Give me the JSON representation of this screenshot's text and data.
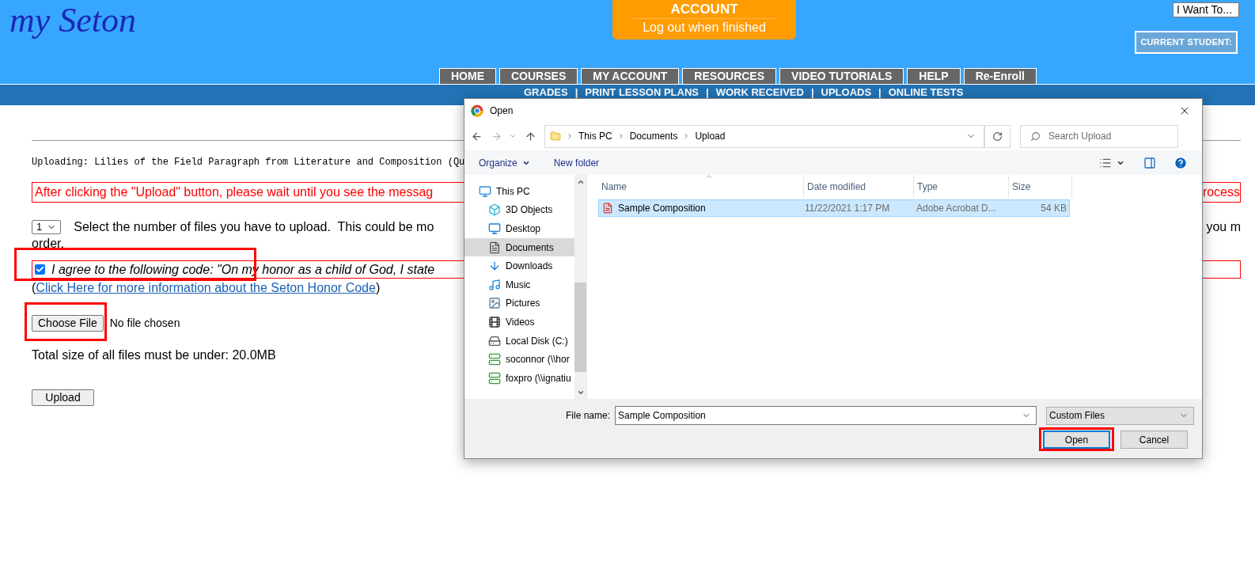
{
  "header": {
    "logo": "my Seton",
    "account": {
      "title": "ACCOUNT",
      "subtitle": "Log out when finished"
    },
    "i_want_to": "I Want To...",
    "current_student": "CURRENT STUDENT:"
  },
  "nav_tabs": [
    {
      "label": "HOME"
    },
    {
      "label": "COURSES"
    },
    {
      "label": "MY ACCOUNT"
    },
    {
      "label": "RESOURCES"
    },
    {
      "label": "VIDEO TUTORIALS"
    },
    {
      "label": "HELP"
    },
    {
      "label": "Re-Enroll"
    }
  ],
  "sub_nav": {
    "separator": "|",
    "items": [
      "GRADES",
      "PRINT LESSON PLANS",
      "WORK RECEIVED",
      "UPLOADS",
      "ONLINE TESTS"
    ]
  },
  "upload_form": {
    "uploading": "Uploading: Lilies of the Field Paragraph from Literature and Composition (Qu",
    "warning": {
      "left": "After clicking the \"Upload\" button, please wait until you see the messag",
      "right": "rocess"
    },
    "file_count": {
      "value": "1",
      "text_left": "Select the number of files you have to upload.  This could be mo",
      "text_right": "you m",
      "text_wrap": "order."
    },
    "honor_code": {
      "checked": true,
      "highlighted": true,
      "label": "I agree to the following code: \"On my honor as a child of God, I state"
    },
    "honor_link": {
      "open": "(",
      "link": "Click Here for more information about the Seton Honor Code",
      "close": ")"
    },
    "choose_file": {
      "button": "Choose File",
      "status": "No file chosen",
      "highlighted": true
    },
    "size_note": "Total size of all files must be under: 20.0MB",
    "upload_button": "Upload"
  },
  "dialog": {
    "title": "Open",
    "path": [
      "This PC",
      "Documents",
      "Upload"
    ],
    "search_placeholder": "Search Upload",
    "toolbar": [
      "Organize",
      "New folder"
    ],
    "nav_pane": [
      {
        "label": "This PC",
        "selected": false,
        "children": [
          {
            "label": "3D Objects",
            "selected": false
          },
          {
            "label": "Desktop",
            "selected": false
          },
          {
            "label": "Documents",
            "selected": true
          },
          {
            "label": "Downloads",
            "selected": false
          },
          {
            "label": "Music",
            "selected": false
          },
          {
            "label": "Pictures",
            "selected": false
          },
          {
            "label": "Videos",
            "selected": false
          },
          {
            "label": "Local Disk (C:)",
            "selected": false
          },
          {
            "label": "soconnor (\\\\hor",
            "selected": false
          },
          {
            "label": "foxpro (\\\\ignatiu",
            "selected": false
          }
        ]
      }
    ],
    "columns": [
      "Name",
      "Date modified",
      "Type",
      "Size"
    ],
    "files": [
      {
        "name": "Sample Composition",
        "date": "11/22/2021 1:17 PM",
        "type": "Adobe Acrobat D...",
        "size": "54 KB",
        "selected": true
      }
    ],
    "file_name_label": "File name:",
    "file_name": "Sample Composition",
    "file_type": "Custom Files",
    "buttons": [
      {
        "label": "Open",
        "default": true,
        "highlighted": true
      },
      {
        "label": "Cancel",
        "default": false,
        "highlighted": false
      }
    ]
  }
}
